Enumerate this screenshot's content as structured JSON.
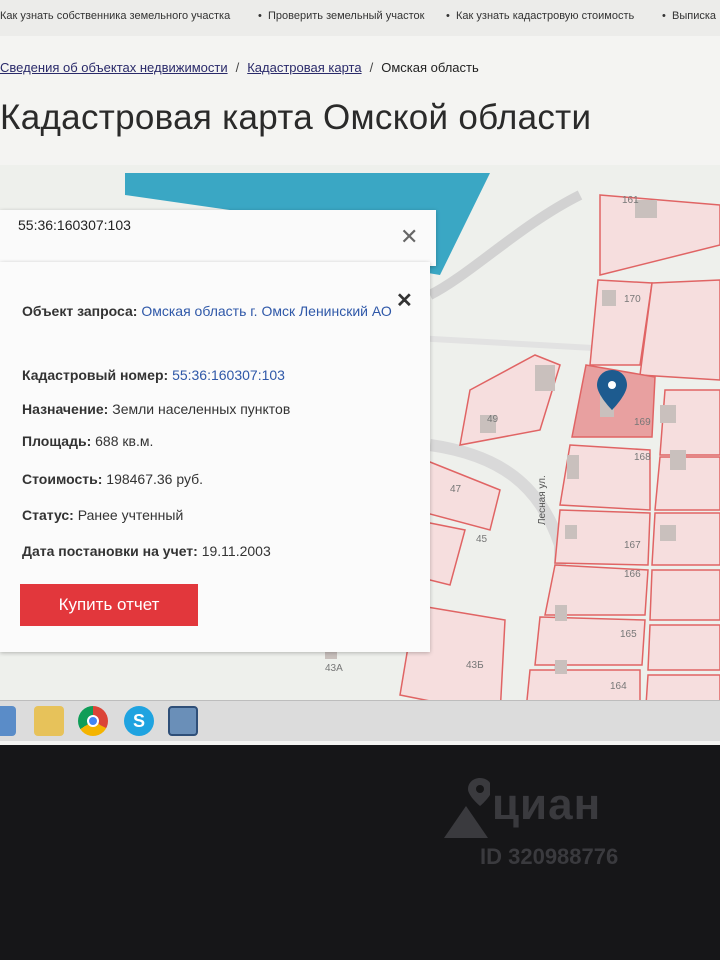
{
  "topnav": {
    "item0": "Как узнать собственника земельного участка",
    "item1": "Проверить земельный участок",
    "item2": "Как узнать кадастровую стоимость",
    "item3": "Выписка"
  },
  "breadcrumb": {
    "item0": "Сведения об объектах недвижимости",
    "item1": "Кадастровая карта",
    "item2": "Омская область",
    "sep": "/"
  },
  "page": {
    "title": "Кадастровая карта Омской области"
  },
  "search": {
    "value": "55:36:160307:103",
    "close": "✕"
  },
  "info": {
    "close": "✕",
    "object_label": "Объект запроса:",
    "object_value": "Омская область г. Омск Ленинский АО",
    "cadnum_label": "Кадастровый номер:",
    "cadnum_value": "55:36:160307:103",
    "purpose_label": "Назначение:",
    "purpose_value": "Земли населенных пунктов",
    "area_label": "Площадь:",
    "area_value": "688 кв.м.",
    "cost_label": "Стоимость:",
    "cost_value": "198467.36 руб.",
    "status_label": "Статус:",
    "status_value": "Ранее учтенный",
    "date_label": "Дата постановки на учет:",
    "date_value": "19.11.2003",
    "buy_label": "Купить отчет"
  },
  "map": {
    "street": "Лесная ул.",
    "lots": [
      "161",
      "170",
      "169",
      "168",
      "167",
      "166",
      "165",
      "164",
      "49",
      "47",
      "45",
      "43",
      "43А",
      "43Б"
    ]
  },
  "taskbar": {
    "icons": [
      "explorer-icon",
      "folder-icon",
      "chrome-icon",
      "skype-icon",
      "network-icon"
    ]
  },
  "watermark": {
    "brand": "циан",
    "id": "ID 320988776"
  },
  "colors": {
    "accent": "#e2373c",
    "link": "#2f58a8",
    "parcel": "#e06464",
    "water": "#3aa7c4"
  }
}
